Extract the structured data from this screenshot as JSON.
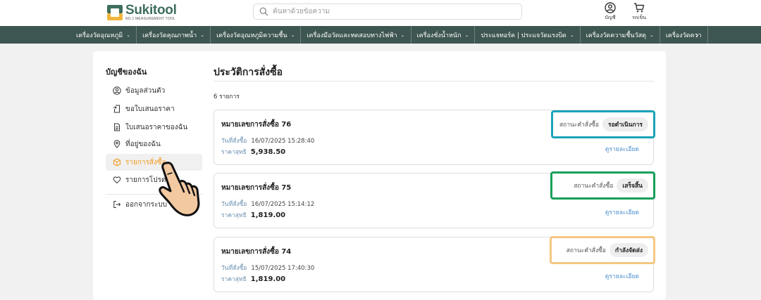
{
  "header": {
    "brand_name": "Sukitool",
    "brand_tagline": "NO.1 MEASUREMENT TOOL",
    "search_placeholder": "ค้นหาด้วยข้อความ",
    "account_label": "บัญชี",
    "cart_label": "รถเข็น",
    "brand_colors": {
      "primary": "#3e6f5c",
      "accent": "#f1b53b"
    }
  },
  "nav": {
    "items": [
      "เครื่องวัดอุณหภูมิ",
      "เครื่องวัดคุณภาพน้ำ",
      "เครื่องวัดอุณหภูมิความชื้น",
      "เครื่องมือวัดและทดสอบทางไฟฟ้า",
      "เครื่องชั่งน้ำหนัก",
      "ประแจทอร์ค | ประแจวัดแรงบิด",
      "เครื่องวัดความชื้นวัสดุ",
      "เครื่องวัดควา"
    ],
    "next_icon": "chevron-right-icon"
  },
  "sidebar": {
    "title": "บัญชีของฉัน",
    "items": [
      {
        "label": "ข้อมูลส่วนตัว",
        "icon": "user-circle-icon"
      },
      {
        "label": "ขอใบเสนอราคา",
        "icon": "file-import-icon"
      },
      {
        "label": "ใบเสนอราคาของฉัน",
        "icon": "document-icon"
      },
      {
        "label": "ที่อยู่ของฉัน",
        "icon": "location-pin-icon"
      },
      {
        "label": "รายการสั่งซื้อ",
        "icon": "box-icon",
        "active": true
      },
      {
        "label": "รายการโปรด",
        "icon": "heart-icon"
      },
      {
        "label": "ออกจากระบบ",
        "icon": "logout-icon"
      }
    ],
    "active_color": "#f29a1f"
  },
  "main": {
    "title": "ประวัติการสั่งซื้อ",
    "count_text": "6 รายการ",
    "orders": [
      {
        "number_label": "หมายเลขการสั่งซื้อ  76",
        "date_label": "วันที่สั่งซื้อ",
        "date": "16/07/2025 15:28:40",
        "price_label": "ราคาสุทธิ",
        "price": "5,938.50",
        "status_label": "สถานะคำสั่งซื้อ",
        "status": "รอดำเนินการ",
        "highlight_color": "#1aa3b8",
        "detail_link": "ดูรายละเอียด"
      },
      {
        "number_label": "หมายเลขการสั่งซื้อ  75",
        "date_label": "วันที่สั่งซื้อ",
        "date": "16/07/2025 15:14:12",
        "price_label": "ราคาสุทธิ",
        "price": "1,819.00",
        "status_label": "สถานะคำสั่งซื้อ",
        "status": "เสร็จสิ้น",
        "highlight_color": "#16a05a",
        "detail_link": "ดูรายละเอียด"
      },
      {
        "number_label": "หมายเลขการสั่งซื้อ  74",
        "date_label": "วันที่สั่งซื้อ",
        "date": "15/07/2025 17:40:30",
        "price_label": "ราคาสุทธิ",
        "price": "1,819.00",
        "status_label": "สถานะคำสั่งซื้อ",
        "status": "กำลังจัดส่ง",
        "highlight_color": "#f5c784",
        "detail_link": "ดูรายละเอียด"
      }
    ]
  },
  "cursor": {
    "icon": "pointing-hand-cursor-icon"
  }
}
